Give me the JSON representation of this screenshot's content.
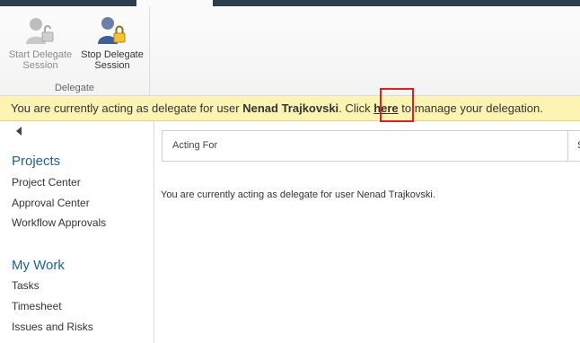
{
  "ribbon": {
    "start_label_1": "Start Delegate",
    "start_label_2": "Session",
    "stop_label_1": "Stop Delegate",
    "stop_label_2": "Session",
    "group_label": "Delegate"
  },
  "banner": {
    "prefix": "You are currently acting as delegate for user ",
    "user": "Nenad Trajkovski",
    "mid": ". Click ",
    "link": "here",
    "suffix": " to manage your delegation."
  },
  "nav": {
    "sections": [
      {
        "heading": "Projects",
        "items": [
          "Project Center",
          "Approval Center",
          "Workflow Approvals"
        ]
      },
      {
        "heading": "My Work",
        "items": [
          "Tasks",
          "Timesheet",
          "Issues and Risks"
        ]
      }
    ]
  },
  "grid": {
    "col1": "Acting For",
    "col2": "S"
  },
  "main": {
    "message": "You are currently acting as delegate for user Nenad Trajkovski."
  },
  "colors": {
    "banner_bg": "#fdf4b4",
    "nav_heading": "#1f5f98",
    "highlight": "#e02020"
  }
}
